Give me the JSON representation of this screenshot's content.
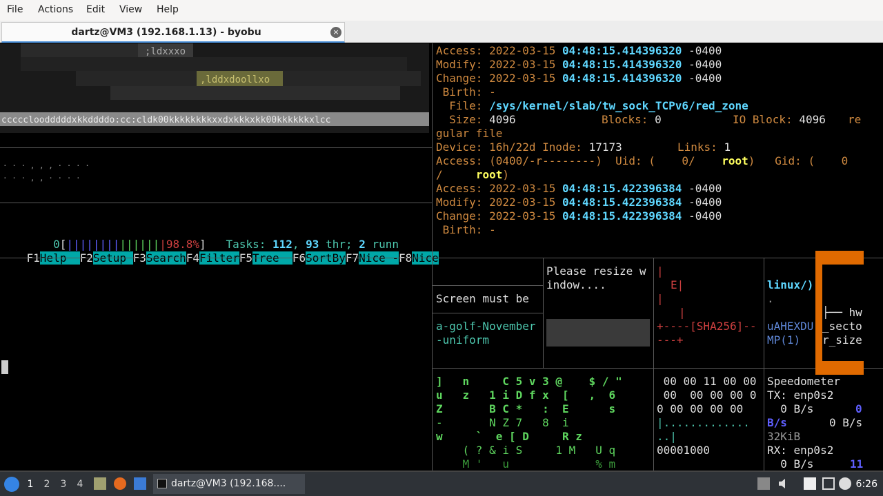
{
  "menu": [
    "File",
    "Actions",
    "Edit",
    "View",
    "Help"
  ],
  "tab": {
    "title": "dartz@VM3 (192.168.1.13) - byobu",
    "close": "×"
  },
  "art_text": {
    "a": ";ldxxxo",
    "b": ",lddxdoollxo",
    "c": "cccccloodddddxkkddddo:cc:cldk00kkkkkkkkxxdxkkkxkk00kkkkkkxlcc"
  },
  "stat": {
    "lines": [
      {
        "label": "Access:",
        "date": "2022-03-15",
        "time": "04:48:15.414396320",
        "tz": "-0400"
      },
      {
        "label": "Modify:",
        "date": "2022-03-15",
        "time": "04:48:15.414396320",
        "tz": "-0400"
      },
      {
        "label": "Change:",
        "date": "2022-03-15",
        "time": "04:48:15.414396320",
        "tz": "-0400"
      }
    ],
    "birth1": " Birth: -",
    "file_label": "  File:",
    "file_path": "/sys/kernel/slab/tw_sock_TCPv6/red_zone",
    "size_label": "  Size:",
    "size_val": "4096",
    "blocks_label": "Blocks:",
    "blocks_val": "0",
    "ioblock_label": "IO Block:",
    "ioblock_val": "4096",
    "type_a": "re",
    "type_b": "gular file",
    "device_label": "Device: 16h/22d Inode:",
    "inode": "17173",
    "links_label": "Links:",
    "links": "1",
    "access_perm": "Access: (0400/-r--------)  Uid: (    0/",
    "uid_name": "root",
    "gid_label": ")   Gid: (    0",
    "gid_cont": "/",
    "gid_name": "root",
    "gid_close": ")",
    "lines2": [
      {
        "label": "Access:",
        "date": "2022-03-15",
        "time": "04:48:15.422396384",
        "tz": "-0400"
      },
      {
        "label": "Modify:",
        "date": "2022-03-15",
        "time": "04:48:15.422396384",
        "tz": "-0400"
      },
      {
        "label": "Change:",
        "date": "2022-03-15",
        "time": "04:48:15.422396384",
        "tz": "-0400"
      }
    ],
    "birth2": " Birth: -"
  },
  "htop": {
    "cpu_num": "0",
    "bar_open": "[",
    "bar_blue": "||||||||",
    "bar_green": "||||||",
    "bar_red": "|98.8%",
    "bar_close": "]",
    "tasks_label": "Tasks:",
    "tasks_count": "112",
    "thr_count": "93",
    "thr_label": "thr;",
    "running_count": "2",
    "running_label": "runn",
    "fkeys": [
      {
        "key": "F1",
        "label": "Help  "
      },
      {
        "key": "F2",
        "label": "Setup "
      },
      {
        "key": "F3",
        "label": "Search"
      },
      {
        "key": "F4",
        "label": "Filter"
      },
      {
        "key": "F5",
        "label": "Tree  "
      },
      {
        "key": "F6",
        "label": "SortBy"
      },
      {
        "key": "F7",
        "label": "Nice -"
      },
      {
        "key": "F8",
        "label": "Nice"
      }
    ]
  },
  "panes": {
    "resize1": "Please resize w",
    "resize2": "indow....",
    "screen_must": "Screen must be",
    "golf1": "a-golf-November",
    "golf2": "-uniform",
    "sha1": "E|",
    "sha2": "+----[SHA256]--",
    "sha3": "---+",
    "linux": "linux/)",
    "dot": ".",
    "hexdump1": "uAHEXDU",
    "hexdump2": "MP(1)",
    "tree1": "├── hw",
    "tree2": "_secto",
    "tree3": "r_size",
    "tree4": "└┬",
    "hex": [
      " 00 00 11 00 00",
      " 00  00 00 00 0",
      "0 00 00 00 00",
      "|.............",
      "..|",
      "00001000"
    ],
    "speed": {
      "title": "Speedometer",
      "tx": "TX: enp0s2",
      "tx_rate": "  0 B/s",
      "tx_zero": "0",
      "bs_label": "B/s",
      "bs_rate": "0 B/s",
      "kib": "32KiB",
      "rx": "RX: enp0s2",
      "rx_rate": "  0 B/s",
      "rx_num": "11"
    }
  },
  "matrix": {
    "rows": [
      "]   n     C 5 v 3 @    $ / \"",
      "u   z   1 i D f x  [   ,  6",
      "Z       B C *   :  E      s",
      "-       N Z 7   8  i",
      "w     `  e [ D     R z",
      "    ( ? & i S     1 M   U q",
      "    M '   u             % m"
    ]
  },
  "taskbar": {
    "workspaces": [
      "1",
      "2",
      "3",
      "4"
    ],
    "task": "dartz@VM3 (192.168....",
    "clock": "6:26"
  }
}
